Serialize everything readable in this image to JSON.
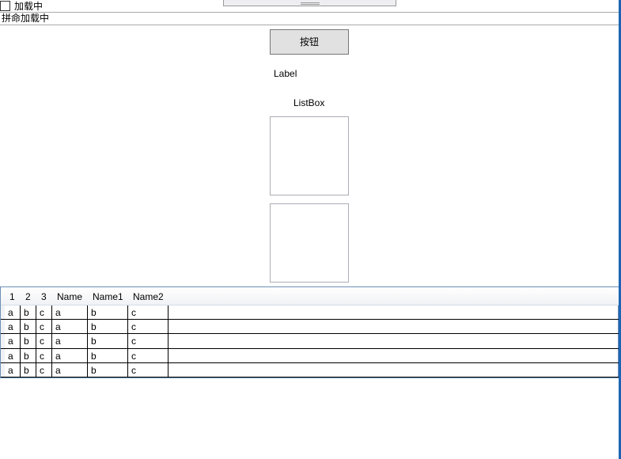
{
  "checkbox": {
    "label": "加载中",
    "checked": false
  },
  "textbox": {
    "value": "拼命加载中"
  },
  "button": {
    "label": "按钮"
  },
  "label": {
    "text": "Label"
  },
  "listbox": {
    "title": "ListBox"
  },
  "grid": {
    "columns": [
      "1",
      "2",
      "3",
      "Name",
      "Name1",
      "Name2"
    ],
    "rows": [
      [
        "a",
        "b",
        "c",
        "a",
        "b",
        "c"
      ],
      [
        "a",
        "b",
        "c",
        "a",
        "b",
        "c"
      ],
      [
        "a",
        "b",
        "c",
        "a",
        "b",
        "c"
      ],
      [
        "a",
        "b",
        "c",
        "a",
        "b",
        "c"
      ],
      [
        "a",
        "b",
        "c",
        "a",
        "b",
        "c"
      ]
    ]
  }
}
